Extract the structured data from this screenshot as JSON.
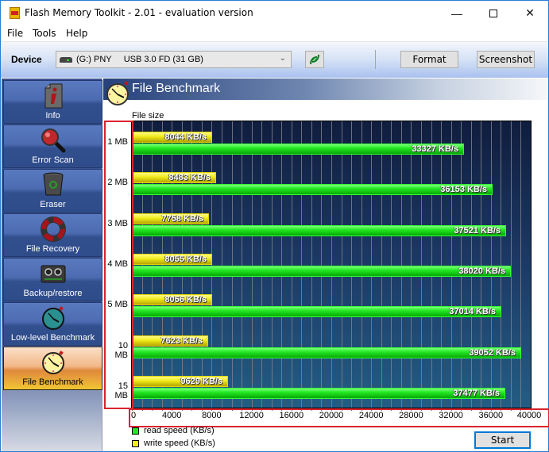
{
  "window": {
    "title": "Flash Memory Toolkit - 2.01 - evaluation version",
    "controls": [
      "minimize",
      "maximize",
      "close"
    ]
  },
  "menu": [
    "File",
    "Tools",
    "Help"
  ],
  "toolbar": {
    "device_label": "Device",
    "device_value": "(G:) PNY     USB 3.0 FD (31 GB)",
    "refresh_icon": "refresh-icon",
    "format_label": "Format",
    "screenshot_label": "Screenshot"
  },
  "sidebar": {
    "items": [
      {
        "label": "Info",
        "icon": "info-icon",
        "active": false
      },
      {
        "label": "Error Scan",
        "icon": "magnifier-icon",
        "active": false
      },
      {
        "label": "Eraser",
        "icon": "trash-icon",
        "active": false
      },
      {
        "label": "File Recovery",
        "icon": "lifebuoy-icon",
        "active": false
      },
      {
        "label": "Backup/restore",
        "icon": "cassette-icon",
        "active": false
      },
      {
        "label": "Low-level Benchmark",
        "icon": "stopwatch-icon",
        "active": false
      },
      {
        "label": "File Benchmark",
        "icon": "stopwatch-icon",
        "active": true
      }
    ]
  },
  "panel": {
    "title": "File Benchmark",
    "start_label": "Start"
  },
  "colors": {
    "read": "#22e822",
    "write": "#f2ee1e",
    "highlight_box": "#d9232e"
  },
  "chart_data": {
    "type": "bar",
    "orientation": "horizontal",
    "ylabel": "File size",
    "categories": [
      "1 MB",
      "2 MB",
      "3 MB",
      "4 MB",
      "5 MB",
      "10 MB",
      "15 MB"
    ],
    "series": [
      {
        "name": "write speed (KB/s)",
        "key": "write",
        "values": [
          8044,
          8483,
          7758,
          8055,
          8056,
          7623,
          9629
        ]
      },
      {
        "name": "read speed (KB/s)",
        "key": "read",
        "values": [
          33327,
          36153,
          37521,
          38020,
          37014,
          39052,
          37477
        ]
      }
    ],
    "value_suffix": " KB/s",
    "xlim": [
      0,
      40000
    ],
    "xticks": [
      0,
      4000,
      8000,
      12000,
      16000,
      20000,
      24000,
      28000,
      32000,
      36000,
      40000
    ],
    "grid": true,
    "legend": [
      {
        "label": "read speed (KB/s)",
        "color": "#22e822"
      },
      {
        "label": "write speed (KB/s)",
        "color": "#f2ee1e"
      }
    ],
    "legend_position": "bottom-left"
  }
}
